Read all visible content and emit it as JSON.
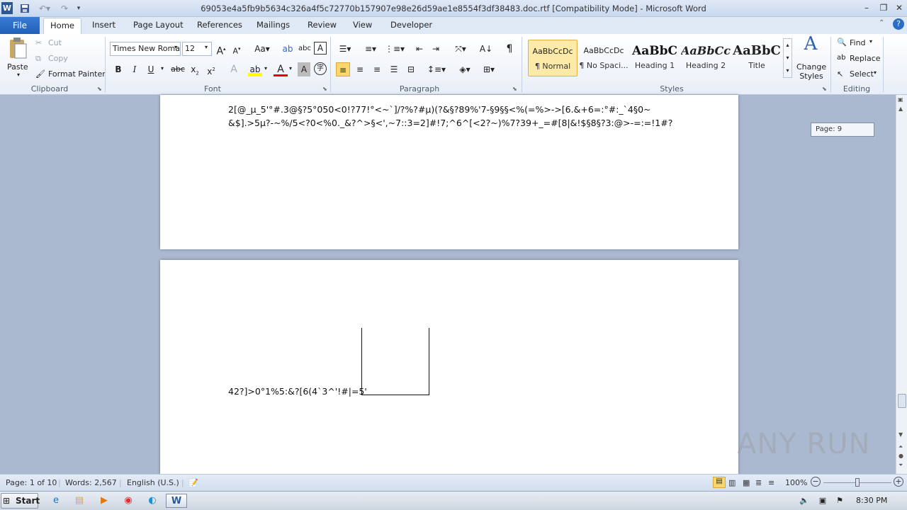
{
  "window": {
    "title": "69053e4a5fb9b5634c326a4f5c72770b157907e98e26d59ae1e8554f3df38483.doc.rtf [Compatibility Mode]  -  Microsoft Word",
    "app_icon": "W"
  },
  "tabs": [
    "File",
    "Home",
    "Insert",
    "Page Layout",
    "References",
    "Mailings",
    "Review",
    "View",
    "Developer"
  ],
  "clipboard": {
    "paste": "Paste",
    "cut": "Cut",
    "copy": "Copy",
    "format_painter": "Format Painter",
    "label": "Clipboard"
  },
  "font": {
    "name": "Times New Roma",
    "size": "12",
    "label": "Font"
  },
  "paragraph": {
    "label": "Paragraph"
  },
  "styles": {
    "items": [
      {
        "preview": "AaBbCcDc",
        "label": "¶ Normal"
      },
      {
        "preview": "AaBbCcDc",
        "label": "¶ No Spaci..."
      },
      {
        "preview": "AaBbC",
        "label": "Heading 1"
      },
      {
        "preview": "AaBbCc",
        "label": "Heading 2"
      },
      {
        "preview": "AaBbC",
        "label": "Title"
      }
    ],
    "change_styles": "Change Styles",
    "label": "Styles"
  },
  "editing": {
    "find": "Find",
    "replace": "Replace",
    "select": "Select",
    "label": "Editing"
  },
  "document": {
    "page1_lines": [
      "2[@_µ_5'°#.3@§?5°050<0!?77!°<~`]/?%?#µ)(?&§?89%'7-§9§§<%(=%>->[6.&+6=:°#:_`4§0~",
      "&$].>5µ?-~%/5<?0<%0._&?^>§<',~7::3=2]#!7;^6^[<2?~)%7?39+_=#[8|&!$§8§?3:@>-=:=!1#?"
    ],
    "page2_line": "42?]>0°1%5:&?[6(4`3^'!#|=5'",
    "page_tooltip": "Page: 9"
  },
  "status": {
    "page": "Page: 1 of 10",
    "words": "Words: 2,567",
    "language": "English (U.S.)",
    "zoom": "100%"
  },
  "taskbar": {
    "start": "Start",
    "time": "8:30 PM"
  },
  "watermark": "ANY RUN"
}
